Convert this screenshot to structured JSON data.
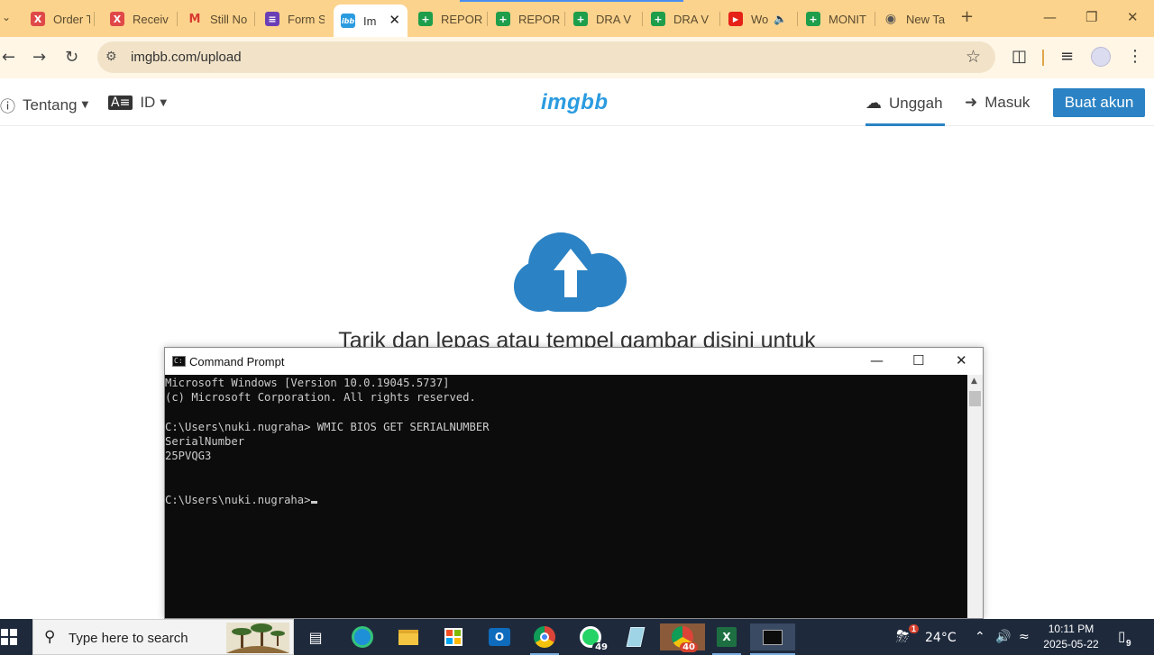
{
  "browser": {
    "tabs": [
      {
        "label": "Order T",
        "fav": "X",
        "color": "#e04848"
      },
      {
        "label": "Receiv",
        "fav": "X",
        "color": "#e04848"
      },
      {
        "label": "Still No",
        "fav": "M",
        "color": "#d93a30"
      },
      {
        "label": "Form S",
        "fav": "≡",
        "color": "#6a3fb6"
      },
      {
        "label": "Im",
        "fav": "ibb",
        "color": "#2b9be0"
      },
      {
        "label": "REPOR",
        "fav": "+",
        "color": "#1e9e4a"
      },
      {
        "label": "REPOR",
        "fav": "+",
        "color": "#1e9e4a"
      },
      {
        "label": "DRA V",
        "fav": "+",
        "color": "#1e9e4a"
      },
      {
        "label": "DRA V",
        "fav": "+",
        "color": "#1e9e4a"
      },
      {
        "label": "Wo",
        "fav": "▶",
        "color": "#e62117"
      },
      {
        "label": "MONIT",
        "fav": "+",
        "color": "#1e9e4a"
      },
      {
        "label": "New Ta",
        "fav": "●",
        "color": "#666666"
      }
    ],
    "url": "imgbb.com/upload"
  },
  "site": {
    "about_label": "Tentang",
    "lang_label": "ID",
    "logo_text": "imgbb",
    "upload_label": "Unggah",
    "login_label": "Masuk",
    "signup_label": "Buat akun",
    "drop_text": "Tarik dan lepas atau tempel gambar disini untuk"
  },
  "cmd": {
    "title": "Command Prompt",
    "lines": [
      "Microsoft Windows [Version 10.0.19045.5737]",
      "(c) Microsoft Corporation. All rights reserved.",
      "",
      "C:\\Users\\nuki.nugraha> WMIC BIOS GET SERIALNUMBER",
      "SerialNumber",
      "25PVQG3",
      "",
      "",
      "C:\\Users\\nuki.nugraha>"
    ]
  },
  "taskbar": {
    "search_placeholder": "Type here to search",
    "whatsapp_badge": "49",
    "chrome_badge": "40",
    "weather_badge": "1",
    "temperature": "24°C",
    "time": "10:11 PM",
    "date": "2025-05-22",
    "notification_count": "9"
  },
  "colors": {
    "tabstrip": "#fbd38d",
    "imgbb_blue": "#2b82c4",
    "console_bg": "#0c0c0c",
    "taskbar": "#1e2a3c"
  }
}
